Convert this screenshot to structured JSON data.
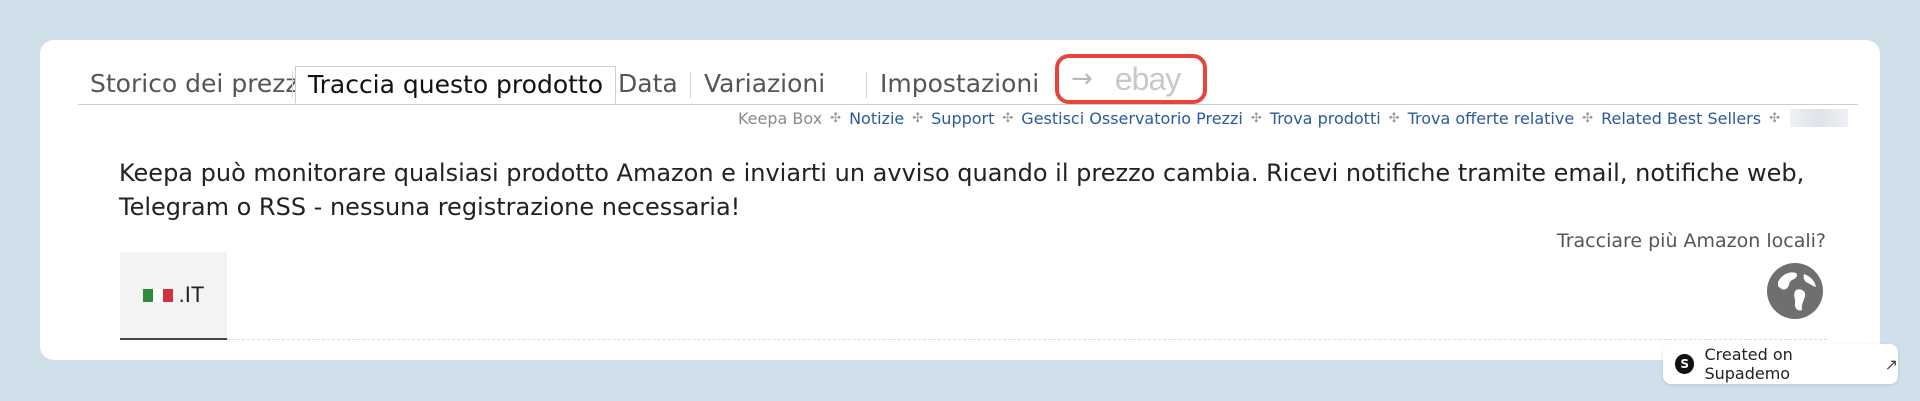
{
  "tabs": [
    {
      "label": "Storico dei prezzi",
      "active": false
    },
    {
      "label": "Traccia questo prodotto",
      "active": true
    },
    {
      "label": "Data",
      "active": false
    },
    {
      "label": "Variazioni",
      "active": false
    },
    {
      "label": "Impostazioni",
      "active": false
    }
  ],
  "ebay_tab": {
    "arrow": "→",
    "label": "ebay"
  },
  "subnav": {
    "keepa_box": "Keepa Box",
    "items": [
      "Notizie",
      "Support",
      "Gestisci Osservatorio Prezzi",
      "Trova prodotti",
      "Trova offerte relative",
      "Related Best Sellers"
    ],
    "separator": "✣"
  },
  "description": "Keepa può monitorare qualsiasi prodotto Amazon e inviarti un avviso quando il prezzo cambia. Ricevi notifiche tramite email, notifiche web, Telegram o RSS - nessuna registrazione necessaria!",
  "multi_locale_label": "Tracciare più Amazon locali?",
  "locale": {
    "code": ".IT",
    "flag_colors": [
      "#2e8b3e",
      "#ffffff",
      "#d2303a"
    ]
  },
  "badge": {
    "logo": "S",
    "text": "Created on Supademo",
    "ext_icon": "↗"
  },
  "colors": {
    "highlight": "#e8443c",
    "link": "#2b5a9b",
    "background": "#cfe0ea"
  }
}
